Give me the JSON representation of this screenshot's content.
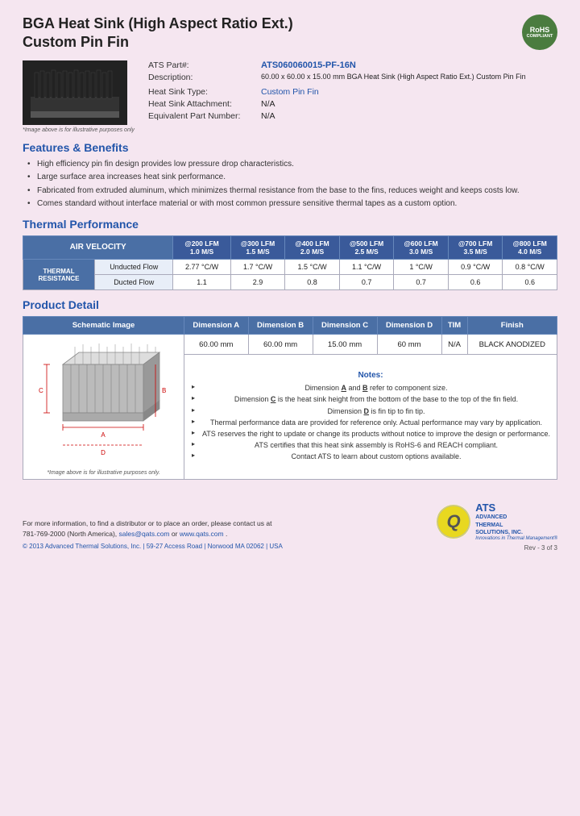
{
  "header": {
    "title_line1": "BGA Heat Sink (High Aspect Ratio Ext.)",
    "title_line2": "Custom Pin Fin",
    "rohs_line1": "RoHS",
    "rohs_line2": "COMPLIANT"
  },
  "product": {
    "ats_part_label": "ATS Part#:",
    "ats_part_value": "ATS060060015-PF-16N",
    "description_label": "Description:",
    "description_value": "60.00 x 60.00 x 15.00 mm BGA Heat Sink (High Aspect Ratio Ext.) Custom Pin Fin",
    "heat_sink_type_label": "Heat Sink Type:",
    "heat_sink_type_value": "Custom Pin Fin",
    "heat_sink_attachment_label": "Heat Sink Attachment:",
    "heat_sink_attachment_value": "N/A",
    "equivalent_part_label": "Equivalent Part Number:",
    "equivalent_part_value": "N/A",
    "image_caption": "*Image above is for illustrative purposes only"
  },
  "features": {
    "title": "Features & Benefits",
    "items": [
      "High efficiency pin fin design provides low pressure drop characteristics.",
      "Large surface area increases heat sink performance.",
      "Fabricated from extruded aluminum, which minimizes thermal resistance from the base to the fins, reduces weight and keeps costs low.",
      "Comes standard without interface material or with most common pressure sensitive thermal tapes as a custom option."
    ]
  },
  "thermal_performance": {
    "title": "Thermal Performance",
    "col_headers": [
      {
        "lfm": "@200 LFM",
        "ms": "1.0 M/S"
      },
      {
        "lfm": "@300 LFM",
        "ms": "1.5 M/S"
      },
      {
        "lfm": "@400 LFM",
        "ms": "2.0 M/S"
      },
      {
        "lfm": "@500 LFM",
        "ms": "2.5 M/S"
      },
      {
        "lfm": "@600 LFM",
        "ms": "3.0 M/S"
      },
      {
        "lfm": "@700 LFM",
        "ms": "3.5 M/S"
      },
      {
        "lfm": "@800 LFM",
        "ms": "4.0 M/S"
      }
    ],
    "air_velocity_label": "AIR VELOCITY",
    "thermal_resistance_label": "THERMAL RESISTANCE",
    "rows": [
      {
        "label": "Unducted Flow",
        "values": [
          "2.77 °C/W",
          "1.7 °C/W",
          "1.5 °C/W",
          "1.1 °C/W",
          "1 °C/W",
          "0.9 °C/W",
          "0.8 °C/W"
        ]
      },
      {
        "label": "Ducted Flow",
        "values": [
          "1.1",
          "2.9",
          "0.8",
          "0.7",
          "0.7",
          "0.6",
          "0.6"
        ]
      }
    ]
  },
  "product_detail": {
    "title": "Product Detail",
    "col_headers": [
      "Schematic Image",
      "Dimension A",
      "Dimension B",
      "Dimension C",
      "Dimension D",
      "TIM",
      "Finish"
    ],
    "dimensions": {
      "dim_a": "60.00 mm",
      "dim_b": "60.00 mm",
      "dim_c": "15.00 mm",
      "dim_d": "60 mm",
      "tim": "N/A",
      "finish": "BLACK ANODIZED"
    },
    "schematic_caption": "*Image above is for illustrative purposes only.",
    "notes_title": "Notes:",
    "notes": [
      "Dimension A and B refer to component size.",
      "Dimension C is the heat sink height from the bottom of the base to the top of the fin field.",
      "Dimension D is fin tip to fin tip.",
      "Thermal performance data are provided for reference only. Actual performance may vary by application.",
      "ATS reserves the right to update or change its products without notice to improve the design or performance.",
      "ATS certifies that this heat sink assembly is RoHS-6 and REACH compliant.",
      "Contact ATS to learn about custom options available."
    ]
  },
  "footer": {
    "contact_line1": "For more information, to find a distributor or to place an order, please contact us at",
    "contact_line2": "781-769-2000 (North America),",
    "email": "sales@qats.com",
    "or_text": " or ",
    "website": "www.qats.com",
    "copyright": "© 2013 Advanced Thermal Solutions, Inc. | 59-27 Access Road | Norwood MA  02062 | USA",
    "ats_logo_q": "Q",
    "ats_logo_brand": "ATS",
    "ats_logo_sub1": "ADVANCED",
    "ats_logo_sub2": "THERMAL",
    "ats_logo_sub3": "SOLUTIONS, INC.",
    "ats_logo_tagline": "Innovations in Thermal Management®",
    "page_num": "Rev - 3 of 3"
  }
}
